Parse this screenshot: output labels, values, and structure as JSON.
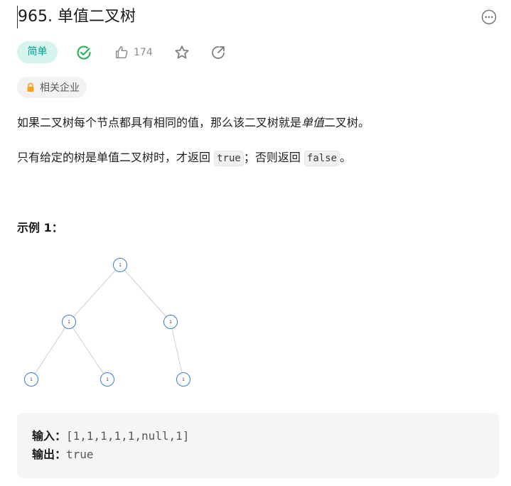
{
  "problem": {
    "title": "965. 单值二叉树",
    "difficulty": "简单",
    "likes": "174",
    "company_tag": "相关企业"
  },
  "description": {
    "p1_before": "如果二叉树每个节点都具有相同的值，那么该二叉树就是",
    "p1_em": "单值",
    "p1_after": "二叉树。",
    "p2_before": "只有给定的树是单值二叉树时，才返回 ",
    "p2_code1": "true",
    "p2_mid": "；否则返回 ",
    "p2_code2": "false",
    "p2_after": "。"
  },
  "example": {
    "title": "示例 1：",
    "tree_node_values": [
      "1",
      "1",
      "1",
      "1",
      "1",
      "1"
    ],
    "input_label": "输入：",
    "input_value": "[1,1,1,1,1,null,1]",
    "output_label": "输出：",
    "output_value": "true"
  },
  "icons": {
    "more": "more-horizontal-icon",
    "solved": "check-circle-icon",
    "like": "thumbs-up-icon",
    "favorite": "star-icon",
    "share": "share-icon",
    "lock": "lock-icon"
  },
  "colors": {
    "difficulty_bg": "#d7f3ee",
    "difficulty_text": "#00a38f",
    "solved_green": "#2db55d",
    "lock_orange": "#ffa116",
    "tree_node_stroke": "#3a7bd5"
  }
}
